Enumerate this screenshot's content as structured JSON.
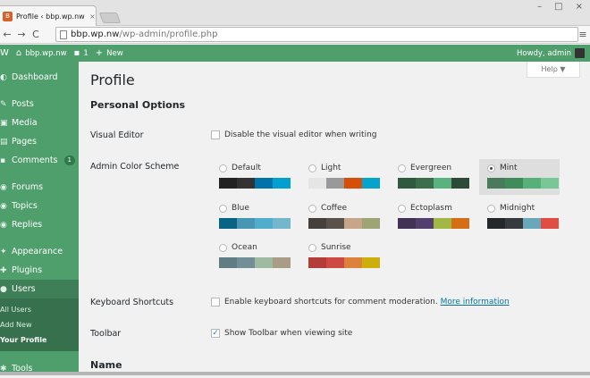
{
  "browser": {
    "tab_title": "Profile ‹ bbp.wp.nw — Wo",
    "tab_close": "×",
    "url_host": "bbp.wp.nw",
    "url_path": "/wp-admin/profile.php",
    "window_buttons": [
      "–",
      "□",
      "×"
    ],
    "nav": {
      "back": "←",
      "forward": "→",
      "reload": "C",
      "menu": "≡"
    }
  },
  "adminbar": {
    "site": "bbp.wp.nw",
    "comments_count": "1",
    "new_label": "New",
    "howdy": "Howdy, admin",
    "wp_icon": "W",
    "home_icon": "⌂",
    "comment_icon": "▪",
    "plus_icon": "+"
  },
  "sidebar": {
    "items": [
      {
        "label": "Dashboard",
        "icon": "dashboard-icon",
        "glyph": "◐"
      },
      {
        "label": "Posts",
        "icon": "pin-icon",
        "glyph": "✎"
      },
      {
        "label": "Media",
        "icon": "media-icon",
        "glyph": "▣"
      },
      {
        "label": "Pages",
        "icon": "pages-icon",
        "glyph": "▤"
      },
      {
        "label": "Comments",
        "icon": "comments-icon",
        "glyph": "▪",
        "badge": "1"
      },
      {
        "label": "Forums",
        "icon": "forums-icon",
        "glyph": "◉"
      },
      {
        "label": "Topics",
        "icon": "topics-icon",
        "glyph": "◉"
      },
      {
        "label": "Replies",
        "icon": "replies-icon",
        "glyph": "◉"
      },
      {
        "label": "Appearance",
        "icon": "appearance-icon",
        "glyph": "✦"
      },
      {
        "label": "Plugins",
        "icon": "plugins-icon",
        "glyph": "✚"
      },
      {
        "label": "Users",
        "icon": "users-icon",
        "glyph": "●"
      },
      {
        "label": "Tools",
        "icon": "tools-icon",
        "glyph": "✱"
      }
    ],
    "submenu": [
      "All Users",
      "Add New",
      "Your Profile"
    ]
  },
  "content": {
    "help": "Help ▼",
    "title": "Profile",
    "personal_options": "Personal Options",
    "visual_editor_label": "Visual Editor",
    "visual_editor_text": "Disable the visual editor when writing",
    "color_scheme_label": "Admin Color Scheme",
    "keyboard_label": "Keyboard Shortcuts",
    "keyboard_text": "Enable keyboard shortcuts for comment moderation.",
    "keyboard_link": "More information",
    "toolbar_label": "Toolbar",
    "toolbar_text": "Show Toolbar when viewing site",
    "toolbar_check": "✓",
    "name_heading": "Name",
    "schemes": [
      {
        "name": "Default",
        "colors": [
          "#222222",
          "#333333",
          "#0073aa",
          "#00a0d2"
        ],
        "selected": false
      },
      {
        "name": "Light",
        "colors": [
          "#e5e5e5",
          "#999999",
          "#d64e07",
          "#04a4cc"
        ],
        "selected": false
      },
      {
        "name": "Evergreen",
        "colors": [
          "#2f5a3f",
          "#3b6e4c",
          "#5ab27e",
          "#2c4a37"
        ],
        "selected": false
      },
      {
        "name": "Mint",
        "colors": [
          "#4a7a5c",
          "#3f8c5a",
          "#57b078",
          "#79c796"
        ],
        "selected": true
      },
      {
        "name": "Blue",
        "colors": [
          "#096484",
          "#4796b3",
          "#52accc",
          "#74b6ce"
        ],
        "selected": false
      },
      {
        "name": "Coffee",
        "colors": [
          "#46403c",
          "#59524c",
          "#c7a589",
          "#9ea476"
        ],
        "selected": false
      },
      {
        "name": "Ectoplasm",
        "colors": [
          "#413256",
          "#523f6d",
          "#a3b745",
          "#d46f15"
        ],
        "selected": false
      },
      {
        "name": "Midnight",
        "colors": [
          "#25282b",
          "#363b3f",
          "#69a8bb",
          "#e14d43"
        ],
        "selected": false
      },
      {
        "name": "Ocean",
        "colors": [
          "#627c83",
          "#738e96",
          "#9ebaa0",
          "#aa9d88"
        ],
        "selected": false
      },
      {
        "name": "Sunrise",
        "colors": [
          "#b43c38",
          "#cf4944",
          "#dd823b",
          "#ccaf0b"
        ],
        "selected": false
      }
    ]
  }
}
